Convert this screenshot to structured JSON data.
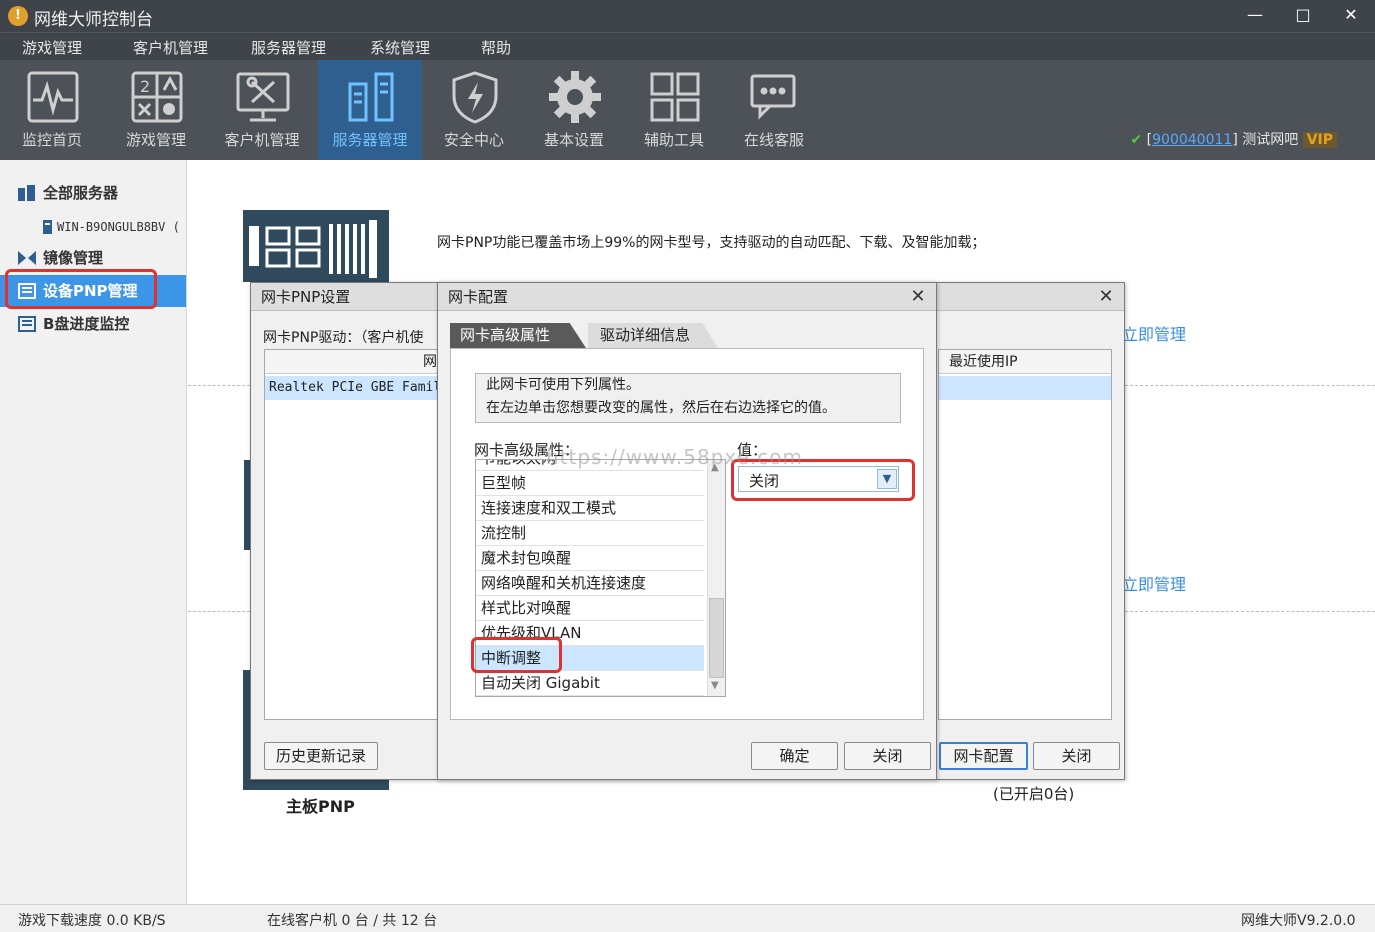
{
  "window": {
    "title": "网维大师控制台",
    "icon_glyph": "!",
    "minimize_glyph": "—",
    "maximize_glyph": "□",
    "close_glyph": "✕"
  },
  "menu": [
    "游戏管理",
    "客户机管理",
    "服务器管理",
    "系统管理",
    "帮助"
  ],
  "toolbar": {
    "items": [
      {
        "label": "监控首页",
        "icon": "monitor-pulse-icon"
      },
      {
        "label": "游戏管理",
        "icon": "game-cards-icon"
      },
      {
        "label": "客户机管理",
        "icon": "tools-monitor-icon"
      },
      {
        "label": "服务器管理",
        "icon": "server-icon",
        "active": true
      },
      {
        "label": "安全中心",
        "icon": "shield-bolt-icon"
      },
      {
        "label": "基本设置",
        "icon": "gear-icon"
      },
      {
        "label": "辅助工具",
        "icon": "grid-icon"
      },
      {
        "label": "在线客服",
        "icon": "chat-bubble-icon"
      }
    ],
    "account": {
      "bracket_open": "[",
      "id": "900040011",
      "bracket_close": "]",
      "name": "测试网吧",
      "vip": "VIP"
    }
  },
  "sidebar": {
    "items": [
      {
        "label": "全部服务器"
      },
      {
        "label": "WIN-B9ONGULB8BV ("
      },
      {
        "label": "镜像管理"
      },
      {
        "label": "设备PNP管理",
        "selected": true
      },
      {
        "label": "B盘进度监控"
      }
    ]
  },
  "main": {
    "pnp_description": "网卡PNP功能已覆盖市场上99%的网卡型号，支持驱动的自动匹配、下载、及智能加载；",
    "manage_link_1": "立即管理",
    "manage_link_2": "立即管理",
    "motherboard_label": "主板PNP",
    "enabled_count": "(已开启0台)"
  },
  "dlg_pnp": {
    "title": "网卡PNP设置",
    "driver_label": "网卡PNP驱动：（客户机使",
    "column_header": "网",
    "row": "Realtek PCIe GBE Family",
    "history_button": "历史更新记录"
  },
  "dlg_right": {
    "column_header": "最近使用IP",
    "config_button": "网卡配置",
    "close_button": "关闭",
    "close_glyph": "✕"
  },
  "dlg_config": {
    "title": "网卡配置",
    "close_glyph": "✕",
    "tabs": [
      "网卡高级属性",
      "驱动详细信息"
    ],
    "info_line1": "此网卡可使用下列属性。",
    "info_line2": "在左边单击您想要改变的属性，然后在右边选择它的值。",
    "props_label": "网卡高级属性：",
    "value_label": "值：",
    "properties": [
      "节能以太网",
      "巨型帧",
      "连接速度和双工模式",
      "流控制",
      "魔术封包唤醒",
      "网络唤醒和关机连接速度",
      "样式比对唤醒",
      "优先级和VLAN",
      "中断调整",
      "自动关闭 Gigabit"
    ],
    "selected_property": "中断调整",
    "value_selected": "关闭",
    "ok_button": "确定",
    "close_button": "关闭",
    "watermark": "https://www.58pxe.com"
  },
  "status": {
    "download_speed": "游戏下载速度 0.0 KB/S",
    "online_clients": "在线客户机 0 台 / 共 12 台",
    "version": "网维大师V9.2.0.0"
  },
  "colors": {
    "titlebar_bg": "#3e4449",
    "toolbar_bg": "#4c5257",
    "active_tool": "#2f5f8e",
    "active_label": "#6fc2ff",
    "selected_side": "#3d95e8",
    "highlight_red": "#e03030",
    "link_blue": "#3a8ee6"
  }
}
